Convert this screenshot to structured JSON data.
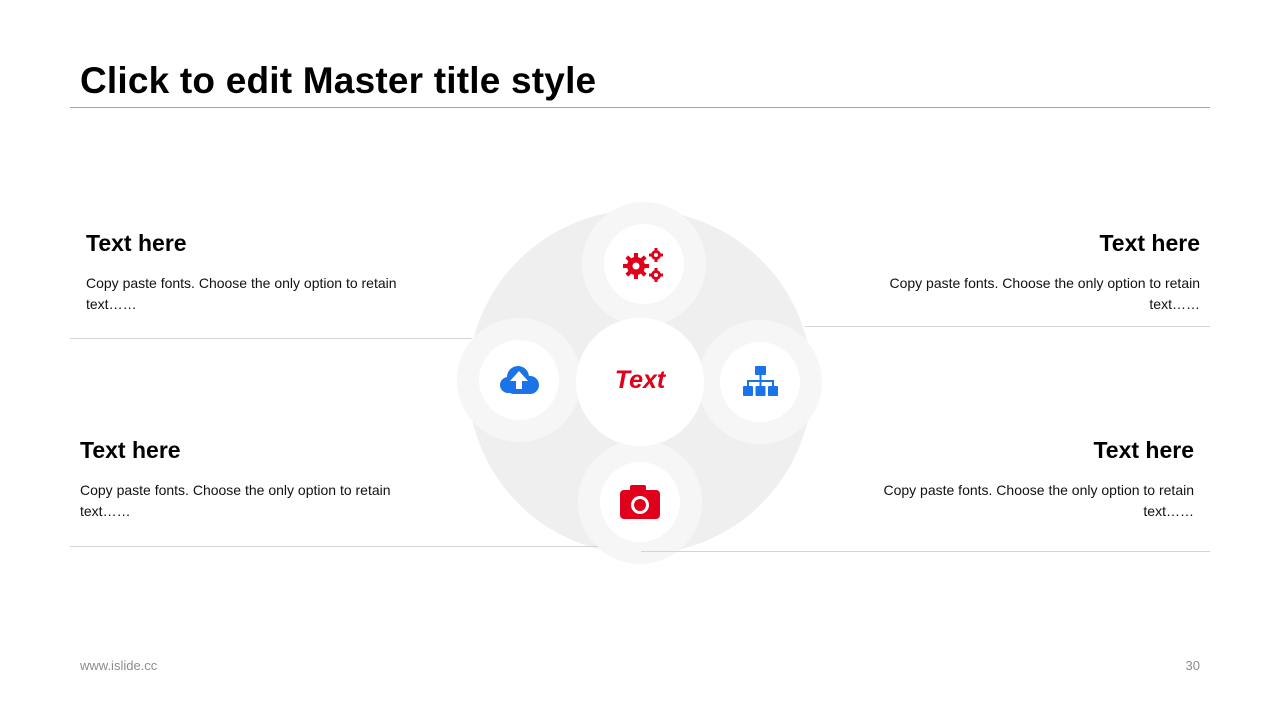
{
  "slide": {
    "title": "Click to edit Master title style",
    "footer_url": "www.islide.cc",
    "page_number": "30"
  },
  "diagram": {
    "center_label": "Text",
    "nodes": [
      {
        "position": "top",
        "icon": "gears-icon",
        "color": "#e0001b"
      },
      {
        "position": "left",
        "icon": "cloud-upload-icon",
        "color": "#1a73e8"
      },
      {
        "position": "right",
        "icon": "sitemap-icon",
        "color": "#1a73e8"
      },
      {
        "position": "bottom",
        "icon": "camera-icon",
        "color": "#e0001b"
      }
    ]
  },
  "blocks": {
    "top_left": {
      "heading": "Text here",
      "body": "Copy paste fonts. Choose the only option to retain text……"
    },
    "top_right": {
      "heading": "Text here",
      "body": "Copy paste fonts. Choose the only option to retain text……"
    },
    "bottom_left": {
      "heading": "Text here",
      "body": "Copy paste fonts. Choose the only option to retain text……"
    },
    "bottom_right": {
      "heading": "Text here",
      "body": "Copy paste fonts. Choose the only option to retain text……"
    }
  },
  "colors": {
    "accent_red": "#e0001b",
    "accent_blue": "#1a73e8",
    "disc_gray": "#efefef"
  }
}
